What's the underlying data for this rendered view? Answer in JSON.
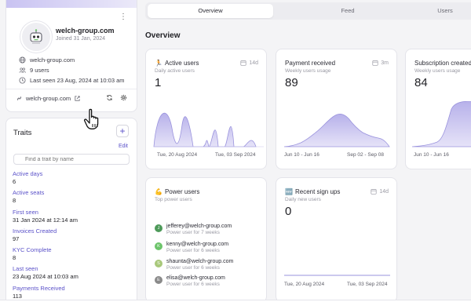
{
  "profile": {
    "name": "welch-group.com",
    "joined": "Joined 31 Jan, 2024",
    "domain": "welch-group.com",
    "users": "9 users",
    "last_seen": "Last seen 23 Aug, 2024 at 10:03 am",
    "website": "welch-group.com"
  },
  "traits": {
    "title": "Traits",
    "edit_label": "Edit",
    "search_placeholder": "Find a trait by name",
    "items": [
      {
        "label": "Active days",
        "value": "6"
      },
      {
        "label": "Active seats",
        "value": "8"
      },
      {
        "label": "First seen",
        "value": "31 Jan 2024 at 12:14 am"
      },
      {
        "label": "Invoices Created",
        "value": "97"
      },
      {
        "label": "KYC Complete",
        "value": "8"
      },
      {
        "label": "Last seen",
        "value": "23 Aug 2024 at 10:03 am"
      },
      {
        "label": "Payments Received",
        "value": "113"
      }
    ]
  },
  "tabs": [
    {
      "label": "Overview",
      "active": true
    },
    {
      "label": "Feed",
      "active": false
    },
    {
      "label": "Users",
      "active": false
    }
  ],
  "overview_title": "Overview",
  "cards": {
    "active_users": {
      "title": "Active users",
      "emoji": "🏃",
      "range": "14d",
      "subtitle": "Daily active users",
      "metric": "1",
      "x_start": "Tue, 20 Aug 2024",
      "x_end": "Tue, 03 Sep 2024"
    },
    "payment_received": {
      "title": "Payment received",
      "range": "3m",
      "subtitle": "Weekly users usage",
      "metric": "89",
      "x_start": "Jun 10 - Jun 16",
      "x_end": "Sep 02 - Sep 08"
    },
    "subscription_created": {
      "title": "Subscription created",
      "subtitle": "Weekly users usage",
      "metric": "84",
      "x_start": "Jun 10 - Jun 16"
    },
    "power_users": {
      "title": "Power users",
      "emoji": "💪",
      "subtitle": "Top power users",
      "users": [
        {
          "initial": "J",
          "email": "jefferey@welch-group.com",
          "meta": "Power user for 7 weeks",
          "color": "#4e9a5a"
        },
        {
          "initial": "K",
          "email": "kenny@welch-group.com",
          "meta": "Power user for 6 weeks",
          "color": "#6cc46a"
        },
        {
          "initial": "S",
          "email": "shaunta@welch-group.com",
          "meta": "Power user for 6 weeks",
          "color": "#a8c87a"
        },
        {
          "initial": "E",
          "email": "elisa@welch-group.com",
          "meta": "Power user for 6 weeks",
          "color": "#8a8a8a"
        }
      ]
    },
    "recent_signups": {
      "title": "Recent sign ups",
      "emoji": "🆕",
      "range": "14d",
      "subtitle": "Daily new users",
      "metric": "0",
      "x_start": "Tue, 20 Aug 2024",
      "x_end": "Tue, 03 Sep 2024"
    }
  },
  "colors": {
    "accent": "#5b52c9",
    "chart_fill": "#c4bfec",
    "chart_line": "#8b84d8"
  }
}
